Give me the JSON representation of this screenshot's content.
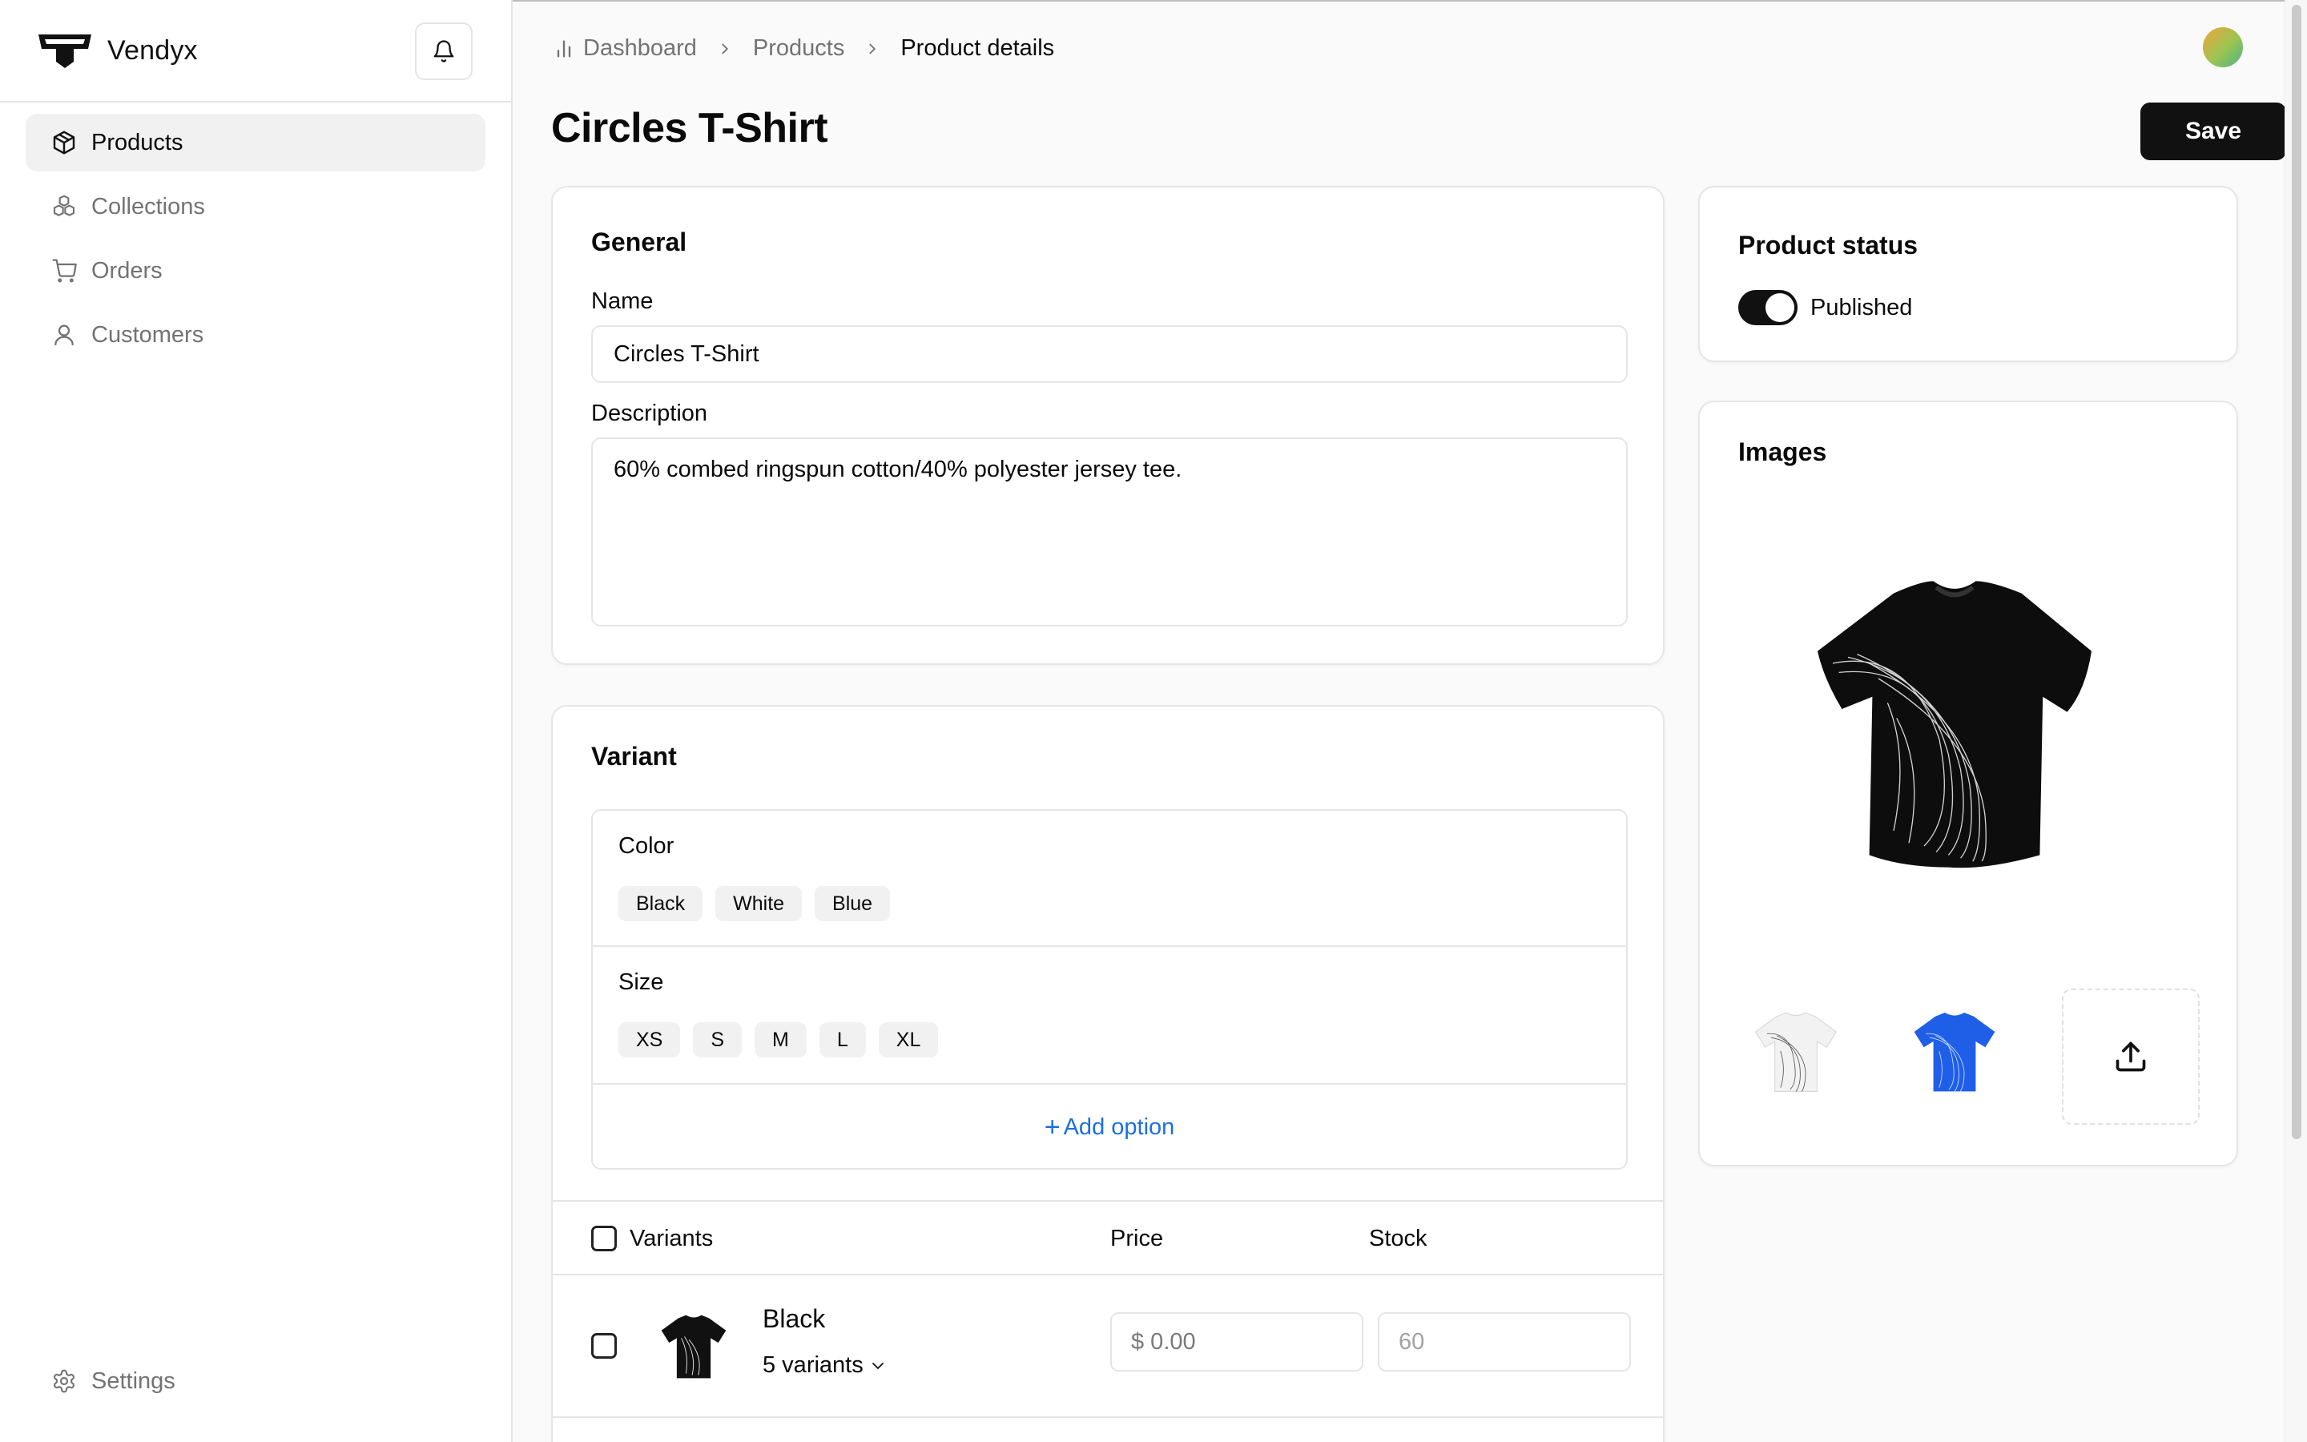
{
  "brand": {
    "name": "Vendyx"
  },
  "sidebar": {
    "items": [
      {
        "label": "Products",
        "icon": "package-icon",
        "active": true
      },
      {
        "label": "Collections",
        "icon": "boxes-icon",
        "active": false
      },
      {
        "label": "Orders",
        "icon": "cart-icon",
        "active": false
      },
      {
        "label": "Customers",
        "icon": "user-icon",
        "active": false
      }
    ],
    "settings_label": "Settings"
  },
  "breadcrumb": {
    "dashboard": "Dashboard",
    "products": "Products",
    "current": "Product details"
  },
  "page": {
    "title": "Circles T-Shirt",
    "save_label": "Save"
  },
  "general": {
    "title": "General",
    "name_label": "Name",
    "name_value": "Circles T-Shirt",
    "description_label": "Description",
    "description_value": "60% combed ringspun cotton/40% polyester jersey tee."
  },
  "variant": {
    "title": "Variant",
    "options": [
      {
        "name": "Color",
        "values": [
          "Black",
          "White",
          "Blue"
        ]
      },
      {
        "name": "Size",
        "values": [
          "XS",
          "S",
          "M",
          "L",
          "XL"
        ]
      }
    ],
    "add_option_label": "Add option",
    "table": {
      "col_variants": "Variants",
      "col_price": "Price",
      "col_stock": "Stock",
      "rows": [
        {
          "name": "Black",
          "variants_label": "5 variants",
          "price": "$ 0.00",
          "stock_placeholder": "60"
        }
      ]
    }
  },
  "status": {
    "title": "Product status",
    "toggle_label": "Published",
    "published": true
  },
  "images": {
    "title": "Images"
  },
  "colors": {
    "accent": "#1d6fe0",
    "primary": "#111111",
    "blue_shirt": "#1f5fe8"
  }
}
